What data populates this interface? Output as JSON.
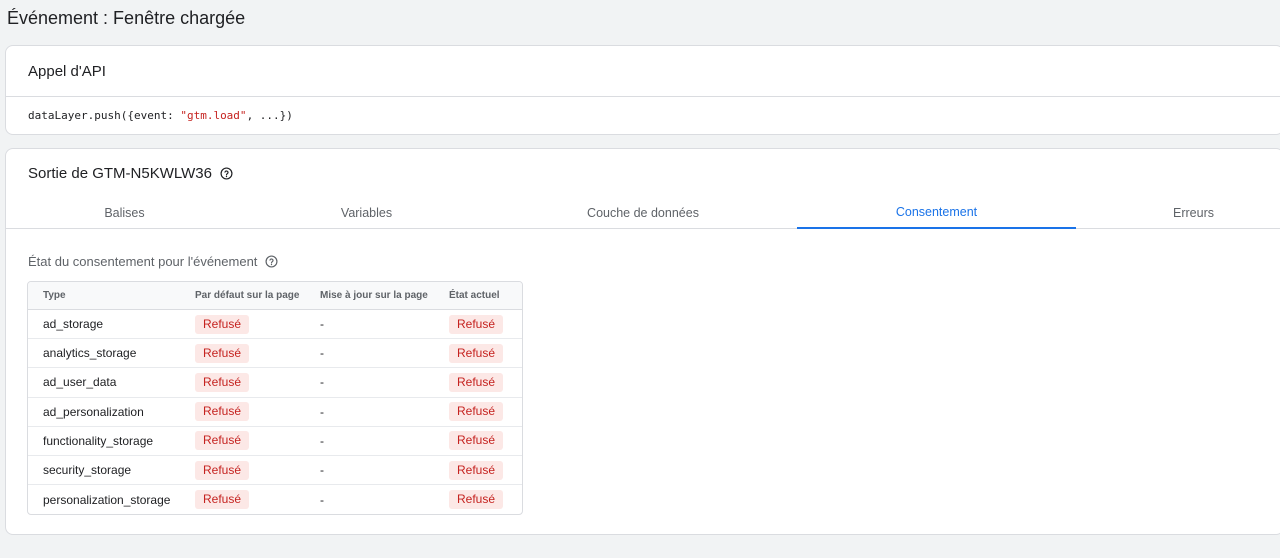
{
  "page": {
    "title": "Événement : Fenêtre chargée"
  },
  "api_card": {
    "title": "Appel d'API",
    "code_prefix": "dataLayer.push({event: ",
    "code_string": "\"gtm.load\"",
    "code_suffix": ", ...})"
  },
  "output_card": {
    "title": "Sortie de GTM-N5KWLW36",
    "tabs": [
      {
        "label": "Balises"
      },
      {
        "label": "Variables"
      },
      {
        "label": "Couche de données"
      },
      {
        "label": "Consentement"
      },
      {
        "label": "Erreurs"
      }
    ],
    "active_tab": "Consentement",
    "consent_title": "État du consentement pour l'événement",
    "table": {
      "headers": [
        "Type",
        "Par défaut sur la page",
        "Mise à jour sur la page",
        "État actuel"
      ],
      "rows": [
        {
          "type": "ad_storage",
          "default": "Refusé",
          "update": "-",
          "current": "Refusé"
        },
        {
          "type": "analytics_storage",
          "default": "Refusé",
          "update": "-",
          "current": "Refusé"
        },
        {
          "type": "ad_user_data",
          "default": "Refusé",
          "update": "-",
          "current": "Refusé"
        },
        {
          "type": "ad_personalization",
          "default": "Refusé",
          "update": "-",
          "current": "Refusé"
        },
        {
          "type": "functionality_storage",
          "default": "Refusé",
          "update": "-",
          "current": "Refusé"
        },
        {
          "type": "security_storage",
          "default": "Refusé",
          "update": "-",
          "current": "Refusé"
        },
        {
          "type": "personalization_storage",
          "default": "Refusé",
          "update": "-",
          "current": "Refusé"
        }
      ]
    }
  },
  "colors": {
    "accent": "#1a73e8",
    "denied_bg": "#fce8e6",
    "denied_text": "#c5221f"
  },
  "icons": {
    "help": "help-circle-icon"
  }
}
